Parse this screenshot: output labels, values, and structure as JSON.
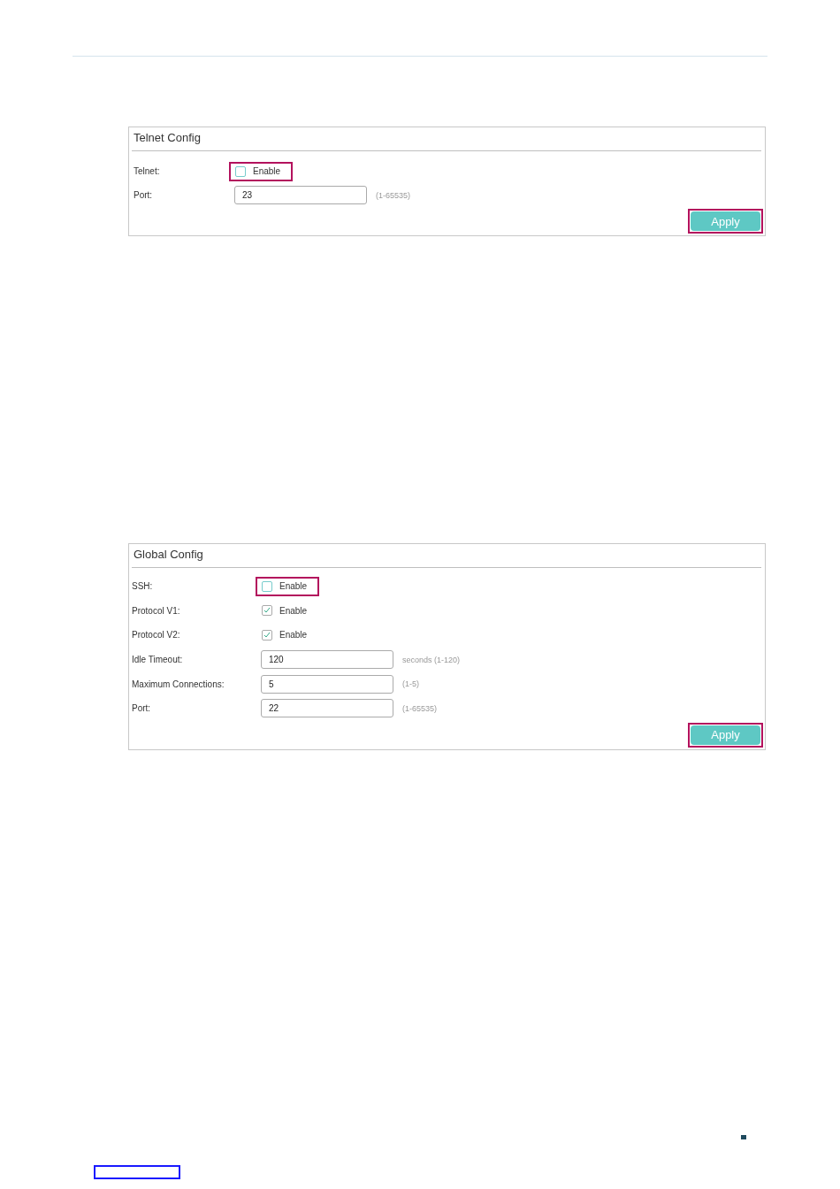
{
  "panels": [
    {
      "title": "Telnet Config",
      "rows": [
        {
          "kind": "checkbox",
          "label": "Telnet:",
          "option": "Enable",
          "checked": false,
          "highlighted": true
        },
        {
          "kind": "input",
          "label": "Port:",
          "value": "23",
          "hint": "(1-65535)"
        }
      ],
      "apply": {
        "label": "Apply",
        "highlighted": true
      }
    },
    {
      "title": "Global Config",
      "rows": [
        {
          "kind": "checkbox",
          "label": "SSH:",
          "option": "Enable",
          "checked": false,
          "highlighted": true
        },
        {
          "kind": "checkbox",
          "label": "Protocol V1:",
          "option": "Enable",
          "checked": true,
          "highlighted": false
        },
        {
          "kind": "checkbox",
          "label": "Protocol V2:",
          "option": "Enable",
          "checked": true,
          "highlighted": false
        },
        {
          "kind": "input",
          "label": "Idle Timeout:",
          "value": "120",
          "hint": "seconds (1-120)"
        },
        {
          "kind": "input",
          "label": "Maximum Connections:",
          "value": "5",
          "hint": "(1-5)"
        },
        {
          "kind": "input",
          "label": "Port:",
          "value": "22",
          "hint": "(1-65535)"
        }
      ],
      "apply": {
        "label": "Apply",
        "highlighted": true
      }
    }
  ]
}
